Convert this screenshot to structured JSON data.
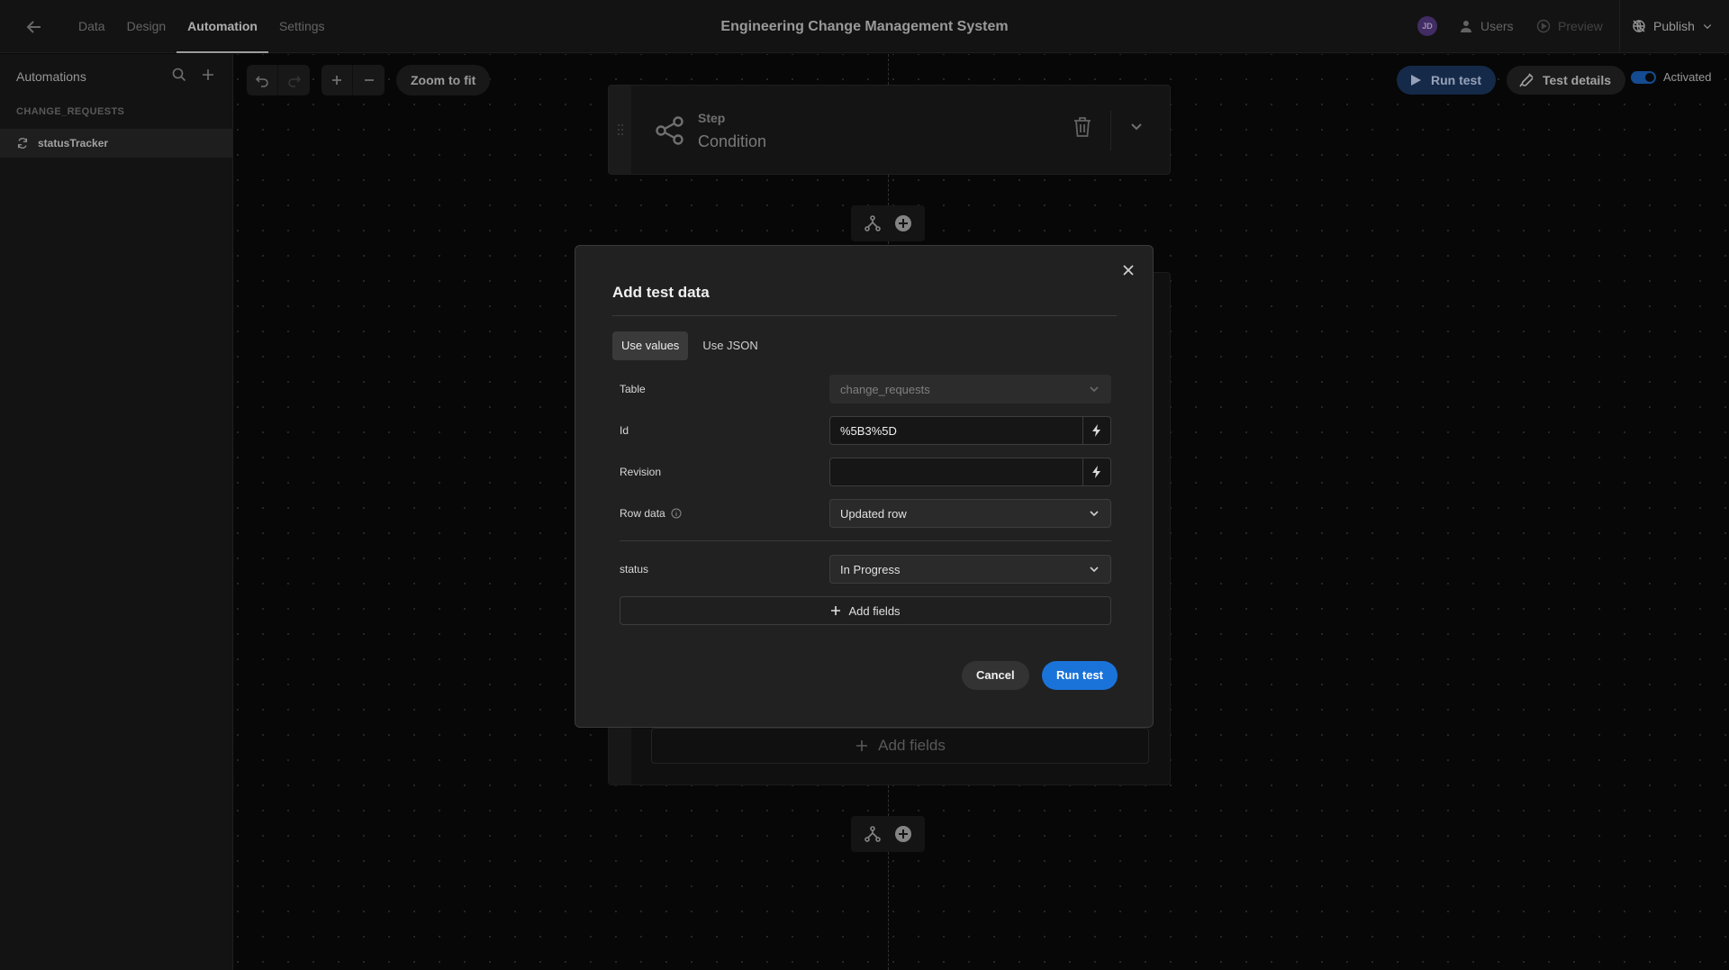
{
  "topbar": {
    "nav": [
      "Data",
      "Design",
      "Automation",
      "Settings"
    ],
    "active_nav": "Automation",
    "app_title": "Engineering Change Management System",
    "avatar_initials": "JD",
    "users_label": "Users",
    "preview_label": "Preview",
    "publish_label": "Publish"
  },
  "sidebar": {
    "title": "Automations",
    "section": "CHANGE_REQUESTS",
    "items": [
      {
        "label": "statusTracker",
        "icon": "sync-icon"
      }
    ]
  },
  "canvas": {
    "zoom_to_fit": "Zoom to fit",
    "run_test": "Run test",
    "test_details": "Test details",
    "activated_label": "Activated",
    "activated": true,
    "step": {
      "label": "Step",
      "name": "Condition"
    },
    "bg_add_fields": "Add fields"
  },
  "modal": {
    "title": "Add test data",
    "tabs": [
      "Use values",
      "Use JSON"
    ],
    "active_tab": "Use values",
    "table": {
      "label": "Table",
      "value": "change_requests"
    },
    "id": {
      "label": "Id",
      "value": "%5B3%5D"
    },
    "revision": {
      "label": "Revision",
      "value": ""
    },
    "row_data": {
      "label": "Row data",
      "value": "Updated row"
    },
    "status": {
      "label": "status",
      "value": "In Progress"
    },
    "add_fields": "Add fields",
    "cancel": "Cancel",
    "run_test": "Run test"
  },
  "colors": {
    "accent": "#1a73d9",
    "run_test_top": "#1e3b66",
    "toggle_on": "#1d68c9",
    "avatar": "#5a3d8a"
  }
}
